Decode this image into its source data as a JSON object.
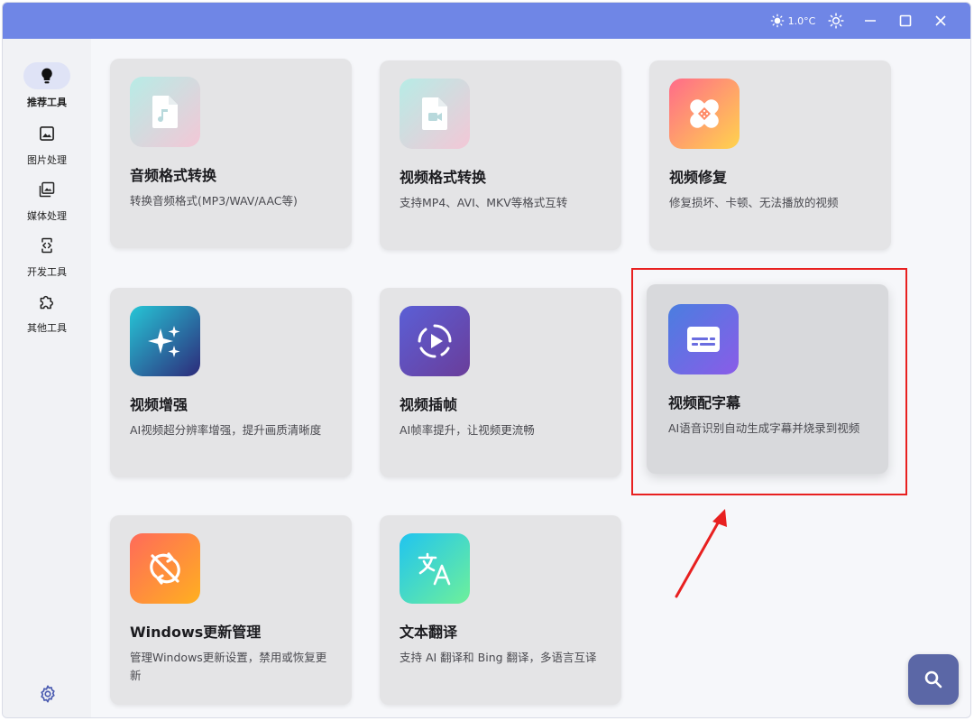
{
  "titlebar": {
    "weather": "1.0°C",
    "weather_icon": "sun-icon",
    "theme_icon": "brightness-icon"
  },
  "sidebar": {
    "items": [
      {
        "label": "推荐工具",
        "icon": "lightbulb-icon",
        "active": true
      },
      {
        "label": "图片处理",
        "icon": "image-icon",
        "active": false
      },
      {
        "label": "媒体处理",
        "icon": "gallery-icon",
        "active": false
      },
      {
        "label": "开发工具",
        "icon": "code-file-icon",
        "active": false
      },
      {
        "label": "其他工具",
        "icon": "puzzle-icon",
        "active": false
      }
    ],
    "settings_icon": "gear-icon"
  },
  "cards": [
    {
      "title": "音频格式转换",
      "desc": "转换音频格式(MP3/WAV/AAC等)",
      "icon": "audio-file-icon"
    },
    {
      "title": "视频格式转换",
      "desc": "支持MP4、AVI、MKV等格式互转",
      "icon": "video-file-icon"
    },
    {
      "title": "视频修复",
      "desc": "修复损坏、卡顿、无法播放的视频",
      "icon": "bandage-icon"
    },
    {
      "title": "视频增强",
      "desc": "AI视频超分辨率增强，提升画质清晰度",
      "icon": "sparkle-icon"
    },
    {
      "title": "视频插帧",
      "desc": "AI帧率提升，让视频更流畅",
      "icon": "play-circle-icon"
    },
    {
      "title": "视频配字幕",
      "desc": "AI语音识别自动生成字幕并烧录到视频",
      "icon": "subtitles-icon"
    },
    {
      "title": "Windows更新管理",
      "desc": "管理Windows更新设置，禁用或恢复更新",
      "icon": "sync-disabled-icon"
    },
    {
      "title": "文本翻译",
      "desc": "支持 AI 翻译和 Bing 翻译，多语言互译",
      "icon": "translate-icon"
    }
  ],
  "colors": {
    "titlebar": "#6f86e6",
    "highlight": "#e82020",
    "fab": "#5b67a6"
  }
}
